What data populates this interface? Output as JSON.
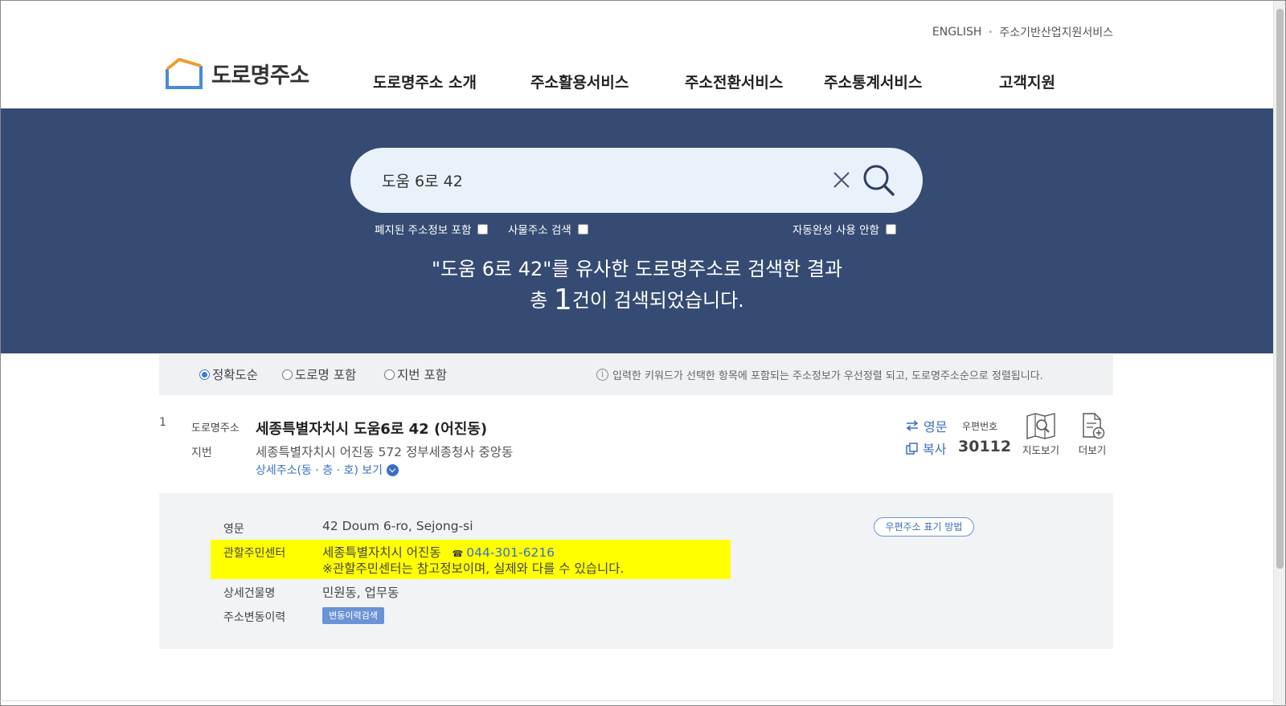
{
  "util_links": {
    "english": "ENGLISH",
    "industry": "주소기반산업지원서비스"
  },
  "logo": {
    "text": "도로명주소"
  },
  "nav": [
    "도로명주소 소개",
    "주소활용서비스",
    "주소전환서비스",
    "주소통계서비스",
    "고객지원"
  ],
  "search": {
    "value": "도움 6로 42",
    "options": {
      "include_abolished": "폐지된 주소정보 포함",
      "thing_address": "사물주소 검색",
      "disable_autocomplete": "자동완성 사용 안함"
    }
  },
  "result_summary": {
    "line1": "\"도움 6로 42\"를 유사한 도로명주소로 검색한 결과",
    "line2_prefix": "총 ",
    "count": "1",
    "line2_suffix": "건이 검색되었습니다."
  },
  "sort": {
    "options": [
      "정확도순",
      "도로명 포함",
      "지번 포함"
    ],
    "selected": "정확도순",
    "note": "입력한 키워드가 선택한 항목에 포함되는 주소정보가 우선정렬 되고, 도로명주소순으로 정렬됩니다."
  },
  "result": {
    "index": "1",
    "road_label": "도로명주소",
    "road_address": "세종특별자치시 도움6로 42 (어진동)",
    "jibun_label": "지번",
    "jibun_address": "세종특별자치시 어진동 572 정부세종청사 중앙동",
    "detail_toggle": "상세주소(동 · 층 · 호) 보기",
    "english_link": "영문",
    "copy_link": "복사",
    "zip_label": "우편번호",
    "zip_code": "30112",
    "map_label": "지도보기",
    "more_label": "더보기"
  },
  "details": {
    "english_label": "영문",
    "english_value": "42 Doum 6-ro, Sejong-si",
    "postal_method_button": "우편주소 표기 방법",
    "center_label": "관할주민센터",
    "center_value": "세종특별자치시 어진동",
    "center_phone": "044-301-6216",
    "center_note": "※관할주민센터는 참고정보이며, 실제와 다를 수 있습니다.",
    "building_label": "상세건물명",
    "building_value": "민원동, 업무동",
    "history_label": "주소변동이력",
    "history_button": "변동이력검색"
  },
  "colors": {
    "hero_bg": "#364b73",
    "accent": "#3b6fc4",
    "highlight": "#ffff00",
    "panel_bg": "#f1f3f5"
  }
}
